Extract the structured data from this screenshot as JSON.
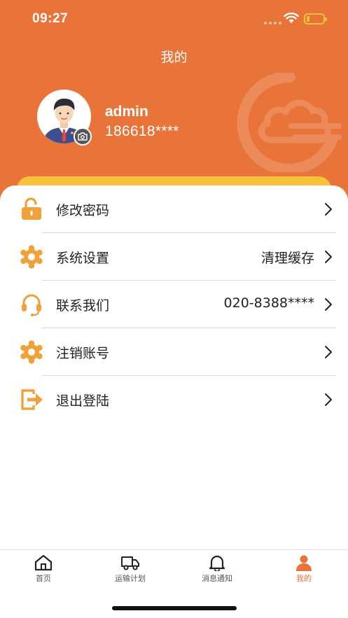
{
  "status_bar": {
    "time": "09:27"
  },
  "header": {
    "title": "我的"
  },
  "profile": {
    "username": "admin",
    "phone": "186618****"
  },
  "menu": {
    "items": [
      {
        "label": "修改密码",
        "value": "",
        "icon": "unlock-icon"
      },
      {
        "label": "系统设置",
        "value": "清理缓存",
        "icon": "gear-icon"
      },
      {
        "label": "联系我们",
        "value": "020-8388****",
        "icon": "headset-icon"
      },
      {
        "label": "注销账号",
        "value": "",
        "icon": "gear-icon"
      },
      {
        "label": "退出登陆",
        "value": "",
        "icon": "logout-icon"
      }
    ]
  },
  "tabbar": {
    "tabs": [
      {
        "label": "首页",
        "icon": "home-icon",
        "active": false
      },
      {
        "label": "运输计划",
        "icon": "truck-icon",
        "active": false
      },
      {
        "label": "消息通知",
        "icon": "bell-icon",
        "active": false
      },
      {
        "label": "我的",
        "icon": "person-icon",
        "active": true
      }
    ]
  },
  "colors": {
    "accent": "#E9743A",
    "strip": "#F7C23A",
    "icon_orange": "#F0A23A"
  }
}
